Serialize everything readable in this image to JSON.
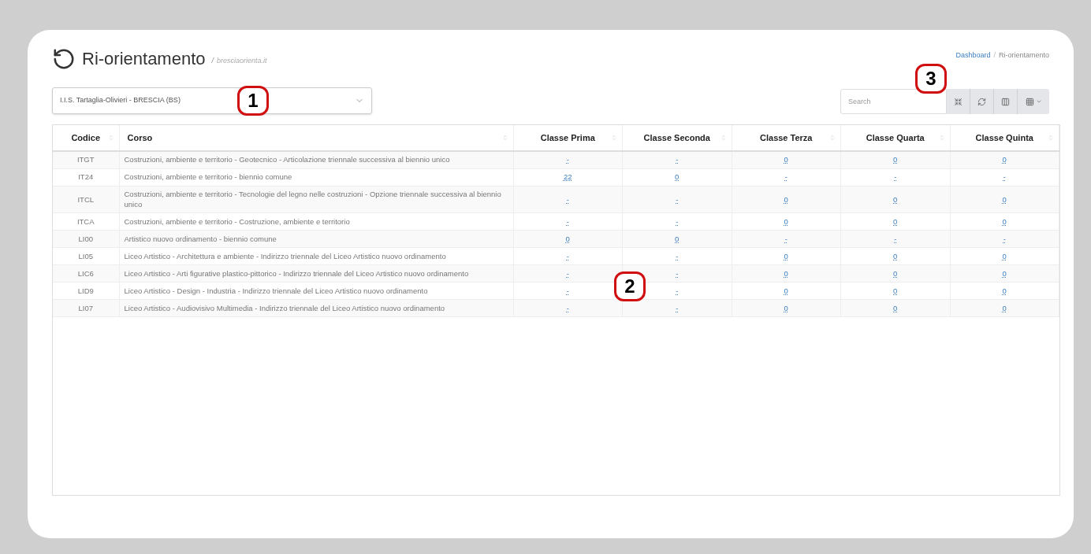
{
  "header": {
    "title": "Ri-orientamento",
    "separator": "/",
    "subtitle": "bresciaorienta.it",
    "breadcrumb_separator": "/",
    "breadcrumb": [
      {
        "label": "Dashboard",
        "selected": false
      },
      {
        "label": "Ri-orientamento",
        "selected": true
      }
    ]
  },
  "school_select": {
    "value": "I.I.S. Tartaglia-Olivieri - BRESCIA (BS)",
    "callout": "1"
  },
  "toolbar": {
    "search": {
      "placeholder": "Search"
    },
    "callout": "3"
  },
  "table": {
    "callout": "2",
    "columns": [
      "Codice",
      "Corso",
      "Classe Prima",
      "Classe Seconda",
      "Classe Terza",
      "Classe Quarta",
      "Classe Quinta"
    ],
    "rows": [
      [
        "ITGT",
        "Costruzioni, ambiente e territorio - Geotecnico - Articolazione triennale successiva al biennio unico",
        "-",
        "-",
        "0",
        "0",
        "0"
      ],
      [
        "IT24",
        "Costruzioni, ambiente e territorio - biennio comune",
        "22",
        "0",
        "-",
        "-",
        "-"
      ],
      [
        "ITCL",
        "Costruzioni, ambiente e territorio - Tecnologie del legno nelle costruzioni - Opzione triennale successiva al biennio unico",
        "-",
        "-",
        "0",
        "0",
        "0"
      ],
      [
        "ITCA",
        "Costruzioni, ambiente e territorio - Costruzione, ambiente e territorio",
        "-",
        "-",
        "0",
        "0",
        "0"
      ],
      [
        "LI00",
        "Artistico nuovo ordinamento - biennio comune",
        "0",
        "0",
        "-",
        "-",
        "-"
      ],
      [
        "LI05",
        "Liceo Artistico - Architettura e ambiente - Indirizzo triennale del Liceo Artistico nuovo ordinamento",
        "-",
        "-",
        "0",
        "0",
        "0"
      ],
      [
        "LIC6",
        "Liceo Artistico - Arti figurative plastico-pittorico - Indirizzo triennale del Liceo Artistico nuovo ordinamento",
        "-",
        "-",
        "0",
        "0",
        "0"
      ],
      [
        "LID9",
        "Liceo Artistico - Design - Industria - Indirizzo triennale del Liceo Artistico nuovo ordinamento",
        "-",
        "-",
        "0",
        "0",
        "0"
      ],
      [
        "LI07",
        "Liceo Artistico - Audiovisivo Multimedia - Indirizzo triennale del Liceo Artistico nuovo ordinamento",
        "-",
        "-",
        "0",
        "0",
        "0"
      ]
    ]
  }
}
